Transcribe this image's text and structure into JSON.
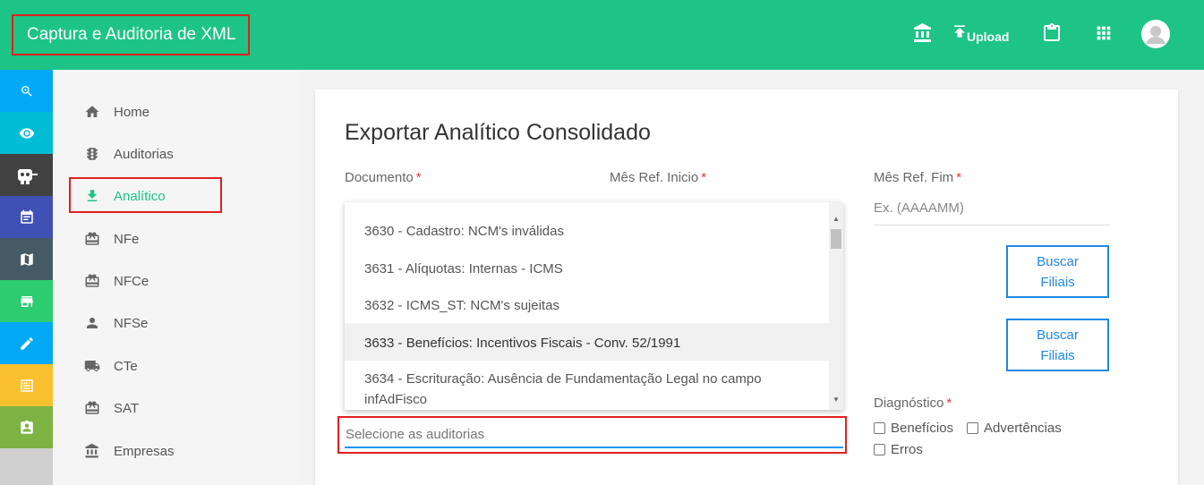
{
  "header": {
    "app_title": "Captura e Auditoria de XML",
    "upload_label": "Upload",
    "icons": [
      "bank-icon",
      "upload-icon",
      "clipboard-icon",
      "apps-grid-icon",
      "avatar-icon"
    ]
  },
  "rail": {
    "items": [
      {
        "name": "zoom-icon",
        "color": "#03a9f4"
      },
      {
        "name": "eye-icon",
        "color": "#00bcd4"
      },
      {
        "name": "robot-icon",
        "color": "#424242"
      },
      {
        "name": "event-icon",
        "color": "#3f51b5"
      },
      {
        "name": "map-icon",
        "color": "#455a64"
      },
      {
        "name": "store-icon",
        "color": "#2ecc71"
      },
      {
        "name": "edit-icon",
        "color": "#03a9f4"
      },
      {
        "name": "receipt-icon",
        "color": "#fbc02d"
      },
      {
        "name": "assignment-ind-icon",
        "color": "#7cb342"
      }
    ]
  },
  "nav": {
    "items": [
      {
        "label": "Home",
        "icon": "home-icon"
      },
      {
        "label": "Auditorias",
        "icon": "traffic-icon"
      },
      {
        "label": "Analítico",
        "icon": "download-icon",
        "active": true
      },
      {
        "label": "NFe",
        "icon": "card-giftcard-icon"
      },
      {
        "label": "NFCe",
        "icon": "card-giftcard-icon"
      },
      {
        "label": "NFSe",
        "icon": "person-icon"
      },
      {
        "label": "CTe",
        "icon": "truck-icon"
      },
      {
        "label": "SAT",
        "icon": "card-giftcard-icon"
      },
      {
        "label": "Empresas",
        "icon": "bank-icon"
      }
    ]
  },
  "main": {
    "title": "Exportar Analítico Consolidado",
    "fields": {
      "documento": {
        "label": "Documento",
        "required": "*"
      },
      "mes_inicio": {
        "label": "Mês Ref. Inicio",
        "required": "*"
      },
      "mes_fim": {
        "label": "Mês Ref. Fim",
        "required": "*",
        "placeholder": "Ex. (AAAAMM)"
      },
      "diagnostico": {
        "label": "Diagnóstico",
        "required": "*"
      }
    },
    "dropdown": {
      "options": [
        "3630 - Cadastro: NCM's inválidas",
        "3631 - Alíquotas: Internas - ICMS",
        "3632 - ICMS_ST: NCM's sujeitas",
        "3633 - Benefícios: Incentivos Fiscais - Conv. 52/1991",
        "3634 - Escrituração: Ausência de Fundamentação Legal no campo infAdFisco"
      ],
      "highlighted_index": 3
    },
    "auditorias_search": {
      "placeholder": "Selecione as auditorias"
    },
    "buttons": {
      "buscar_filiais_1": "Buscar Filiais",
      "buscar_filiais_2": "Buscar Filiais"
    },
    "checkboxes": {
      "beneficios": "Benefícios",
      "advertencias": "Advertências",
      "erros": "Erros"
    }
  }
}
